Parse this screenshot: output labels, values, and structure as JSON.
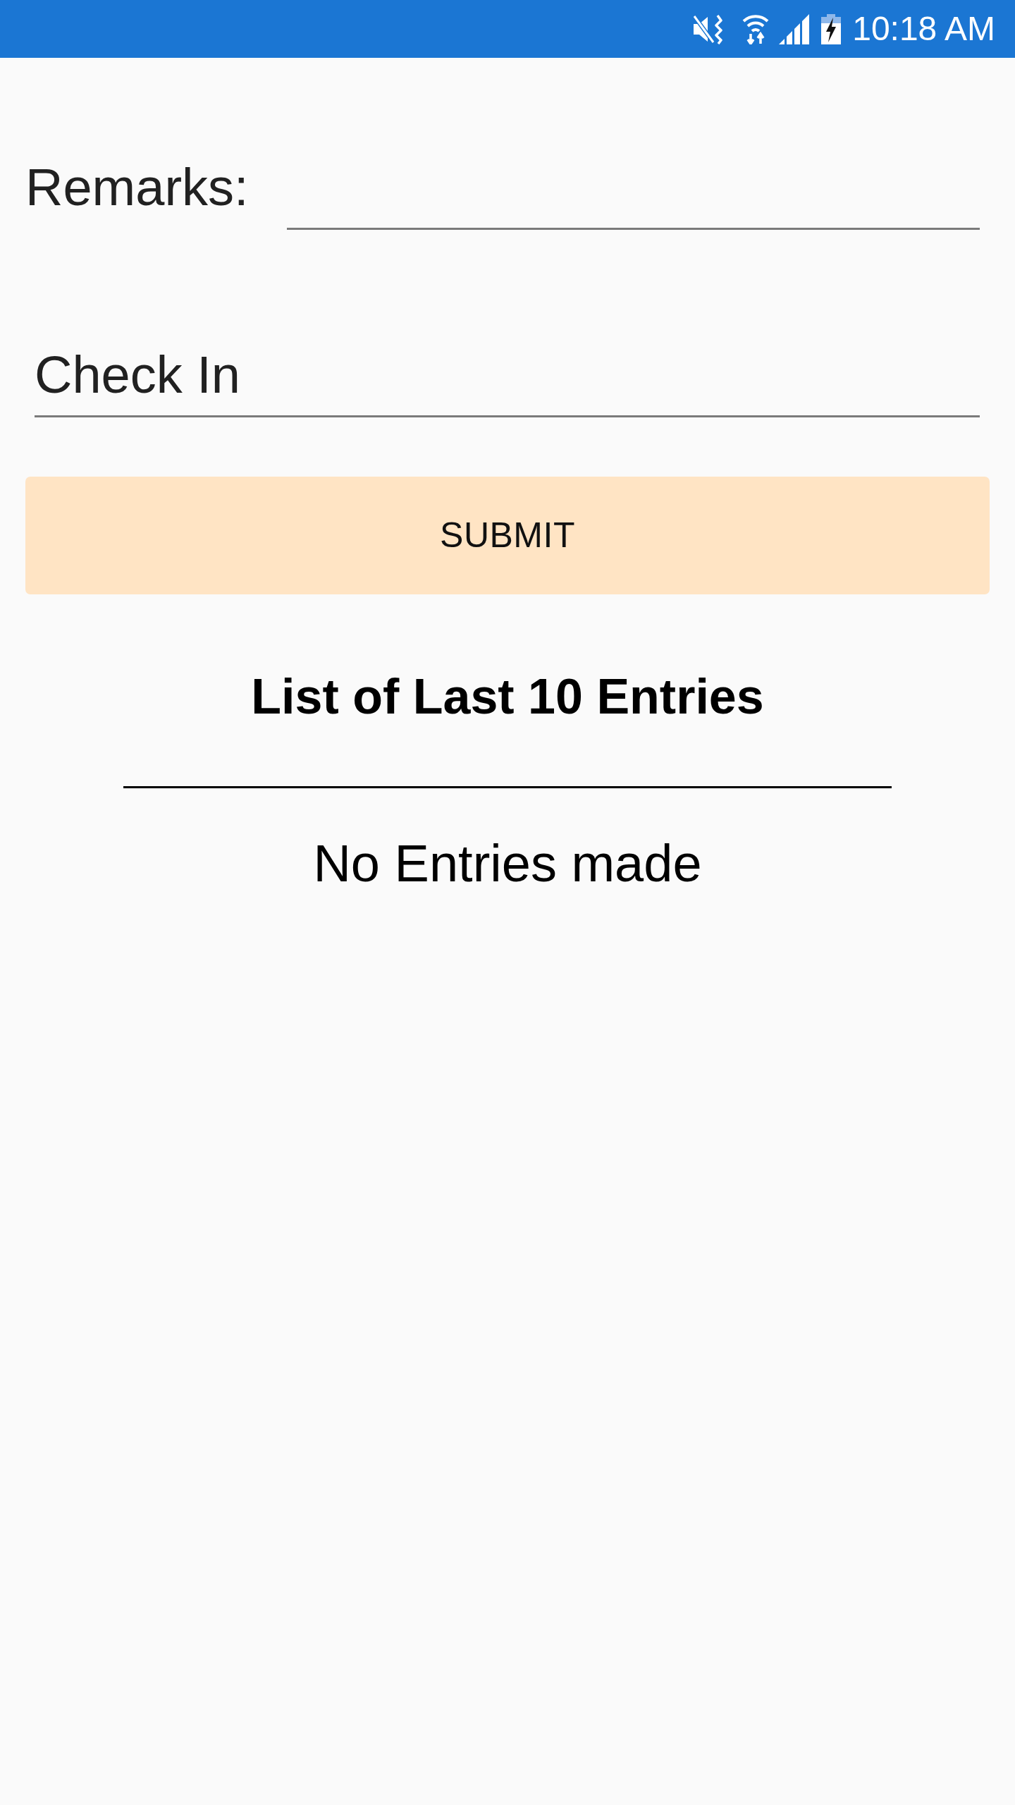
{
  "status_bar": {
    "time": "10:18 AM"
  },
  "form": {
    "remarks": {
      "label": "Remarks:"
    },
    "entry_type": {
      "value": "Check In"
    },
    "submit_button": "SUBMIT"
  },
  "entries": {
    "title": "List of Last 10 Entries",
    "empty_message": "No Entries made"
  }
}
